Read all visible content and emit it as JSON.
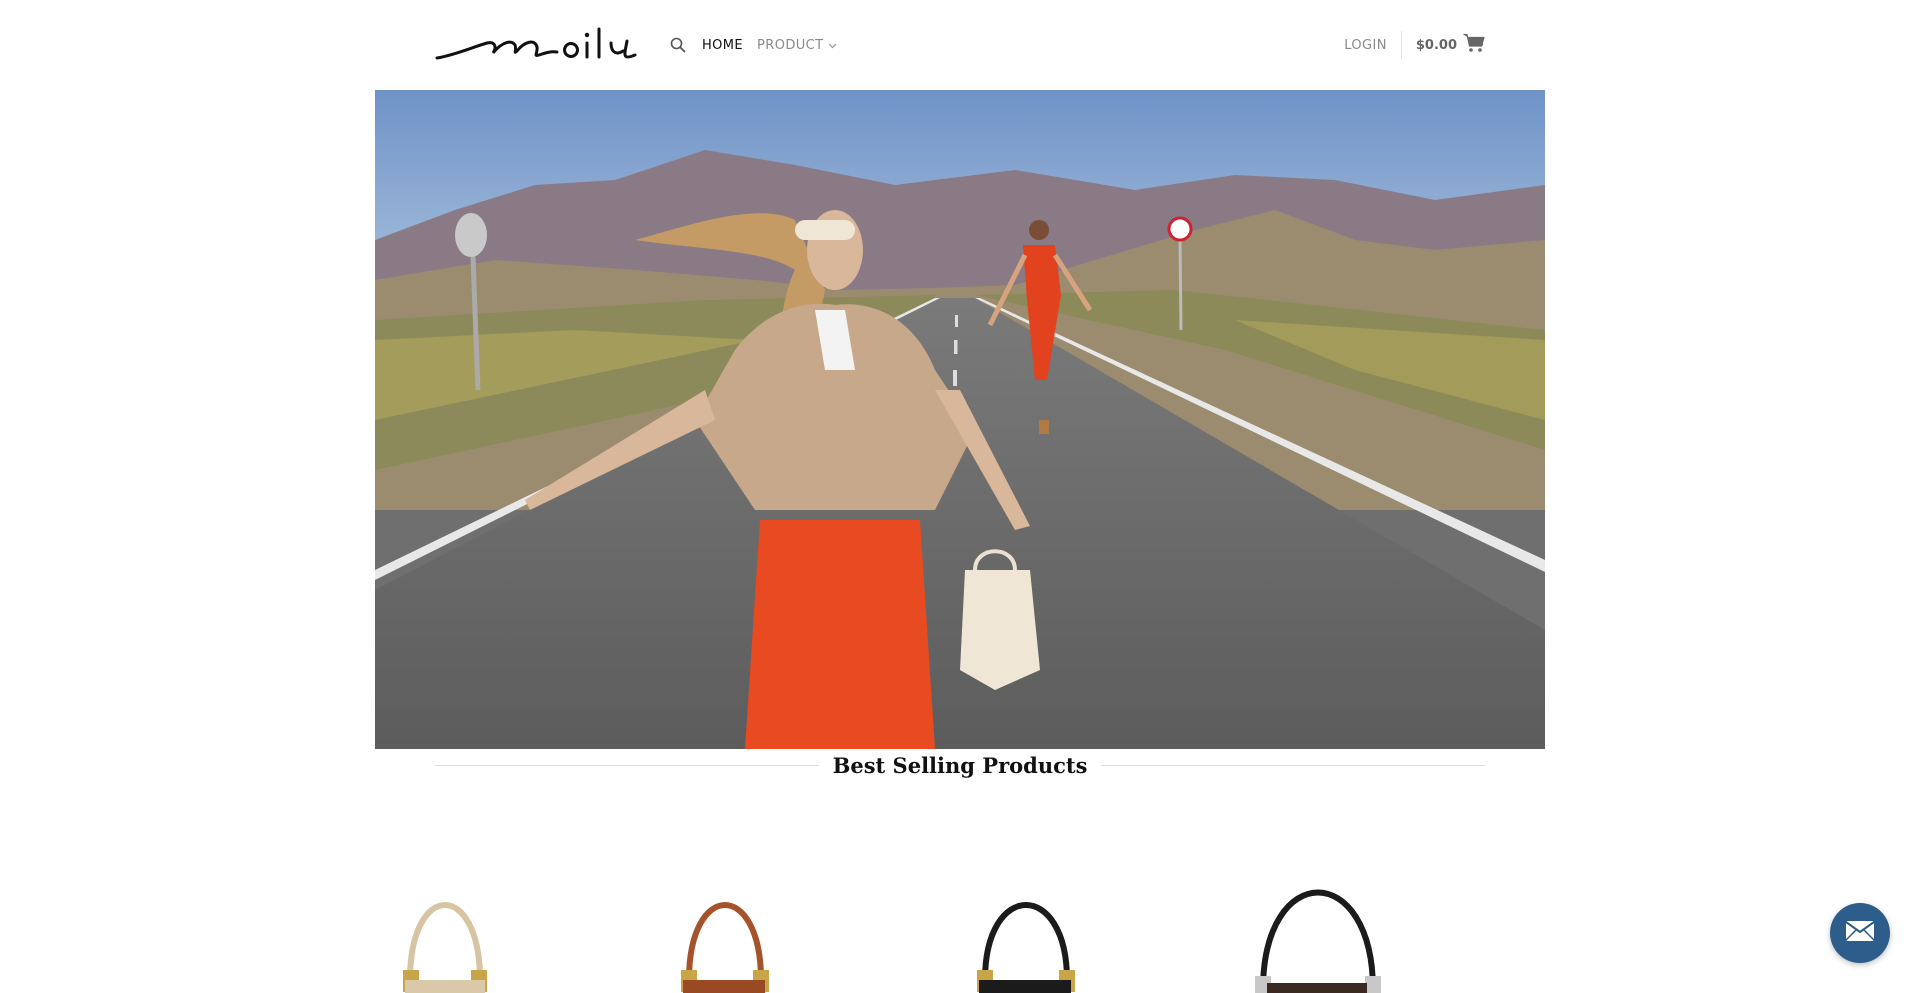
{
  "brand": {
    "logo_text": "moily"
  },
  "nav": {
    "search_icon": "search-icon",
    "items": [
      {
        "label": "HOME",
        "active": true
      },
      {
        "label": "PRODUCT",
        "has_dropdown": true
      }
    ]
  },
  "account": {
    "login_label": "LOGIN",
    "cart_total": "$0.00",
    "cart_icon": "cart-icon"
  },
  "hero": {
    "image_alt": "Two women walking on a desert road, one in a beige jacket carrying a cream bucket bag"
  },
  "sections": {
    "best_selling_title": "Best Selling Products"
  },
  "products": [
    {
      "color": "#d9c9a8",
      "handle_color": "#d6c4a3"
    },
    {
      "color": "#9a4a23",
      "handle_color": "#a5532a"
    },
    {
      "color": "#1b1b1b",
      "handle_color": "#1b1b1b"
    },
    {
      "color": "#3a2a22",
      "handle_color": "#1b1b1b"
    }
  ],
  "floating": {
    "mail_icon": "mail-icon"
  },
  "colors": {
    "accent": "#2d5d8a",
    "text_dark": "#111111",
    "text_muted": "#8a8a8a"
  }
}
